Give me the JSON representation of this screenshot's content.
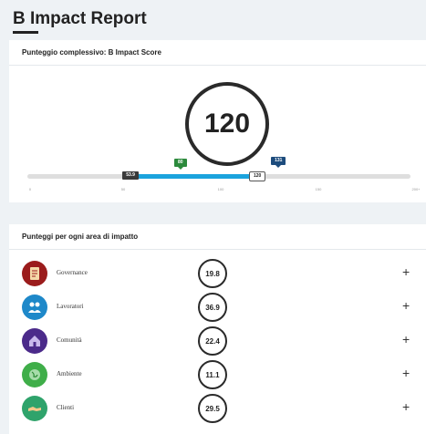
{
  "title": "B Impact Report",
  "overall": {
    "header": "Punteggio complessivo: B Impact Score",
    "score": "120",
    "markers": {
      "median": "53.9",
      "qualify": "80",
      "best": "131",
      "score": "120"
    },
    "scale": {
      "min": 0,
      "max": 200,
      "ticks": [
        "0",
        "50",
        "100",
        "150",
        "200+"
      ]
    }
  },
  "areas": {
    "header": "Punteggi per ogni area di impatto",
    "items": [
      {
        "label": "Governance",
        "score": "19.8",
        "icon": "governance-document-icon",
        "color": "#9b1c1c"
      },
      {
        "label": "Lavoratori",
        "score": "36.9",
        "icon": "workers-people-icon",
        "color": "#1e88c9"
      },
      {
        "label": "Comunità",
        "score": "22.4",
        "icon": "community-house-icon",
        "color": "#4b2a8a"
      },
      {
        "label": "Ambiente",
        "score": "11.1",
        "icon": "environment-globe-icon",
        "color": "#3fae49"
      },
      {
        "label": "Clienti",
        "score": "29.5",
        "icon": "customers-handshake-icon",
        "color": "#2fa36b"
      }
    ],
    "expand_label": "+"
  },
  "colors": {
    "progress": "#1ba3dd",
    "median_marker": "#3a3a3a",
    "qualify_marker": "#2c8a3c",
    "best_marker": "#1d4c7d"
  }
}
